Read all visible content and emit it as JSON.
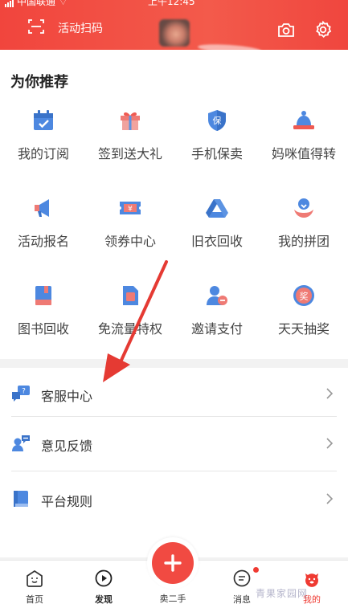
{
  "status_bar": {
    "carrier": "中国联通",
    "time": "上午12:45"
  },
  "header": {
    "scan_label": "活动扫码"
  },
  "recommend": {
    "title": "为你推荐",
    "items": [
      {
        "label": "我的订阅",
        "icon": "calendar-icon"
      },
      {
        "label": "签到送大礼",
        "icon": "gift-icon"
      },
      {
        "label": "手机保卖",
        "icon": "shield-icon"
      },
      {
        "label": "妈咪值得转",
        "icon": "bell-icon"
      },
      {
        "label": "活动报名",
        "icon": "megaphone-icon"
      },
      {
        "label": "领券中心",
        "icon": "coupon-icon"
      },
      {
        "label": "旧衣回收",
        "icon": "recycle-icon"
      },
      {
        "label": "我的拼团",
        "icon": "group-icon"
      },
      {
        "label": "图书回收",
        "icon": "book-icon"
      },
      {
        "label": "免流量特权",
        "icon": "sim-icon"
      },
      {
        "label": "邀请支付",
        "icon": "invite-icon"
      },
      {
        "label": "天天抽奖",
        "icon": "lottery-icon"
      }
    ]
  },
  "list": {
    "items": [
      {
        "label": "客服中心"
      },
      {
        "label": "意见反馈"
      },
      {
        "label": "平台规则"
      }
    ]
  },
  "tabbar": {
    "items": [
      {
        "label": "首页"
      },
      {
        "label": "发现"
      },
      {
        "label": "卖二手"
      },
      {
        "label": "消息"
      },
      {
        "label": "我的"
      }
    ]
  },
  "colors": {
    "brand": "#f1453d",
    "icon_blue": "#4d88e0",
    "icon_red": "#ef5a52"
  },
  "watermark": "青果家园网"
}
